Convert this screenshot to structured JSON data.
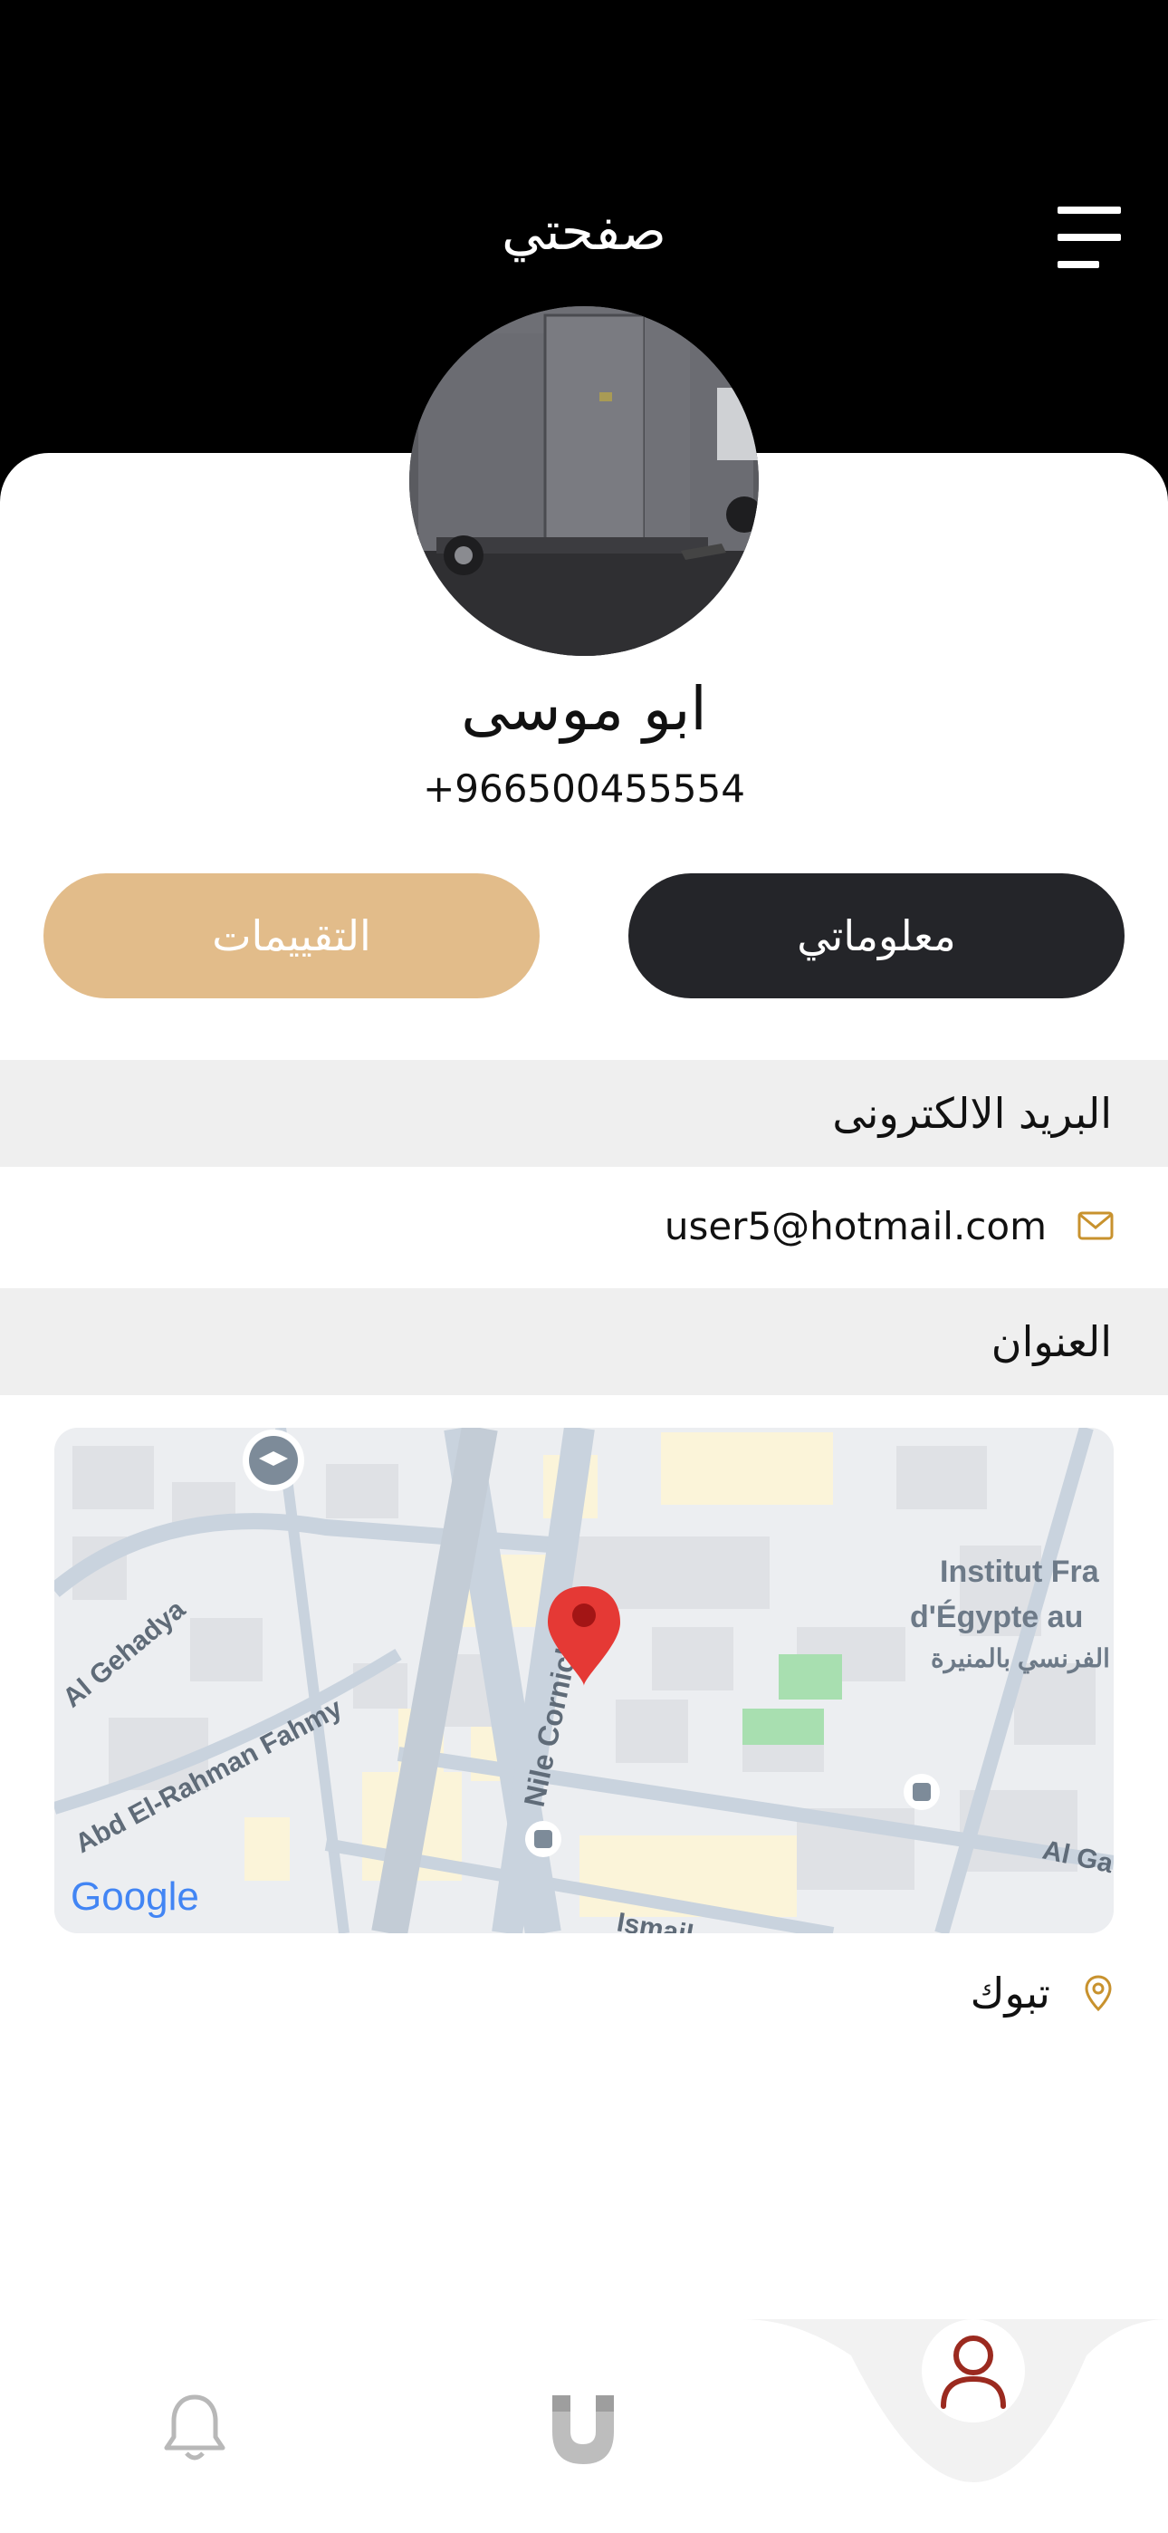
{
  "header": {
    "title": "صفحتي"
  },
  "profile": {
    "name": "ابو موسى",
    "phone": "+966500455554"
  },
  "tabs": {
    "info_label": "معلوماتي",
    "ratings_label": "التقييمات"
  },
  "sections": {
    "email_title": "البريد الالكترونى",
    "email_value": "user5@hotmail.com",
    "address_title": "العنوان",
    "city": "تبوك"
  },
  "map": {
    "labels": {
      "street_1": "Al Gehadya",
      "street_2": "Abd El-Rahman Fahmy",
      "street_3": "Nile Corniche",
      "street_4": "Ismail...",
      "street_5": "Al Ga",
      "poi_line1": "Institut Fra",
      "poi_line2": "d'Égypte au",
      "poi_line3": "الفرنسي بالمنيرة"
    },
    "attribution": "Google"
  },
  "colors": {
    "accent": "#e2bc8a",
    "dark_button": "#242529",
    "icon_gold": "#c8922e",
    "active_nav": "#9b2a1f"
  },
  "bottom_nav": {
    "items": [
      {
        "icon": "bell-icon",
        "active": false
      },
      {
        "icon": "magnet-icon",
        "active": false
      },
      {
        "icon": "user-icon",
        "active": true
      }
    ]
  }
}
